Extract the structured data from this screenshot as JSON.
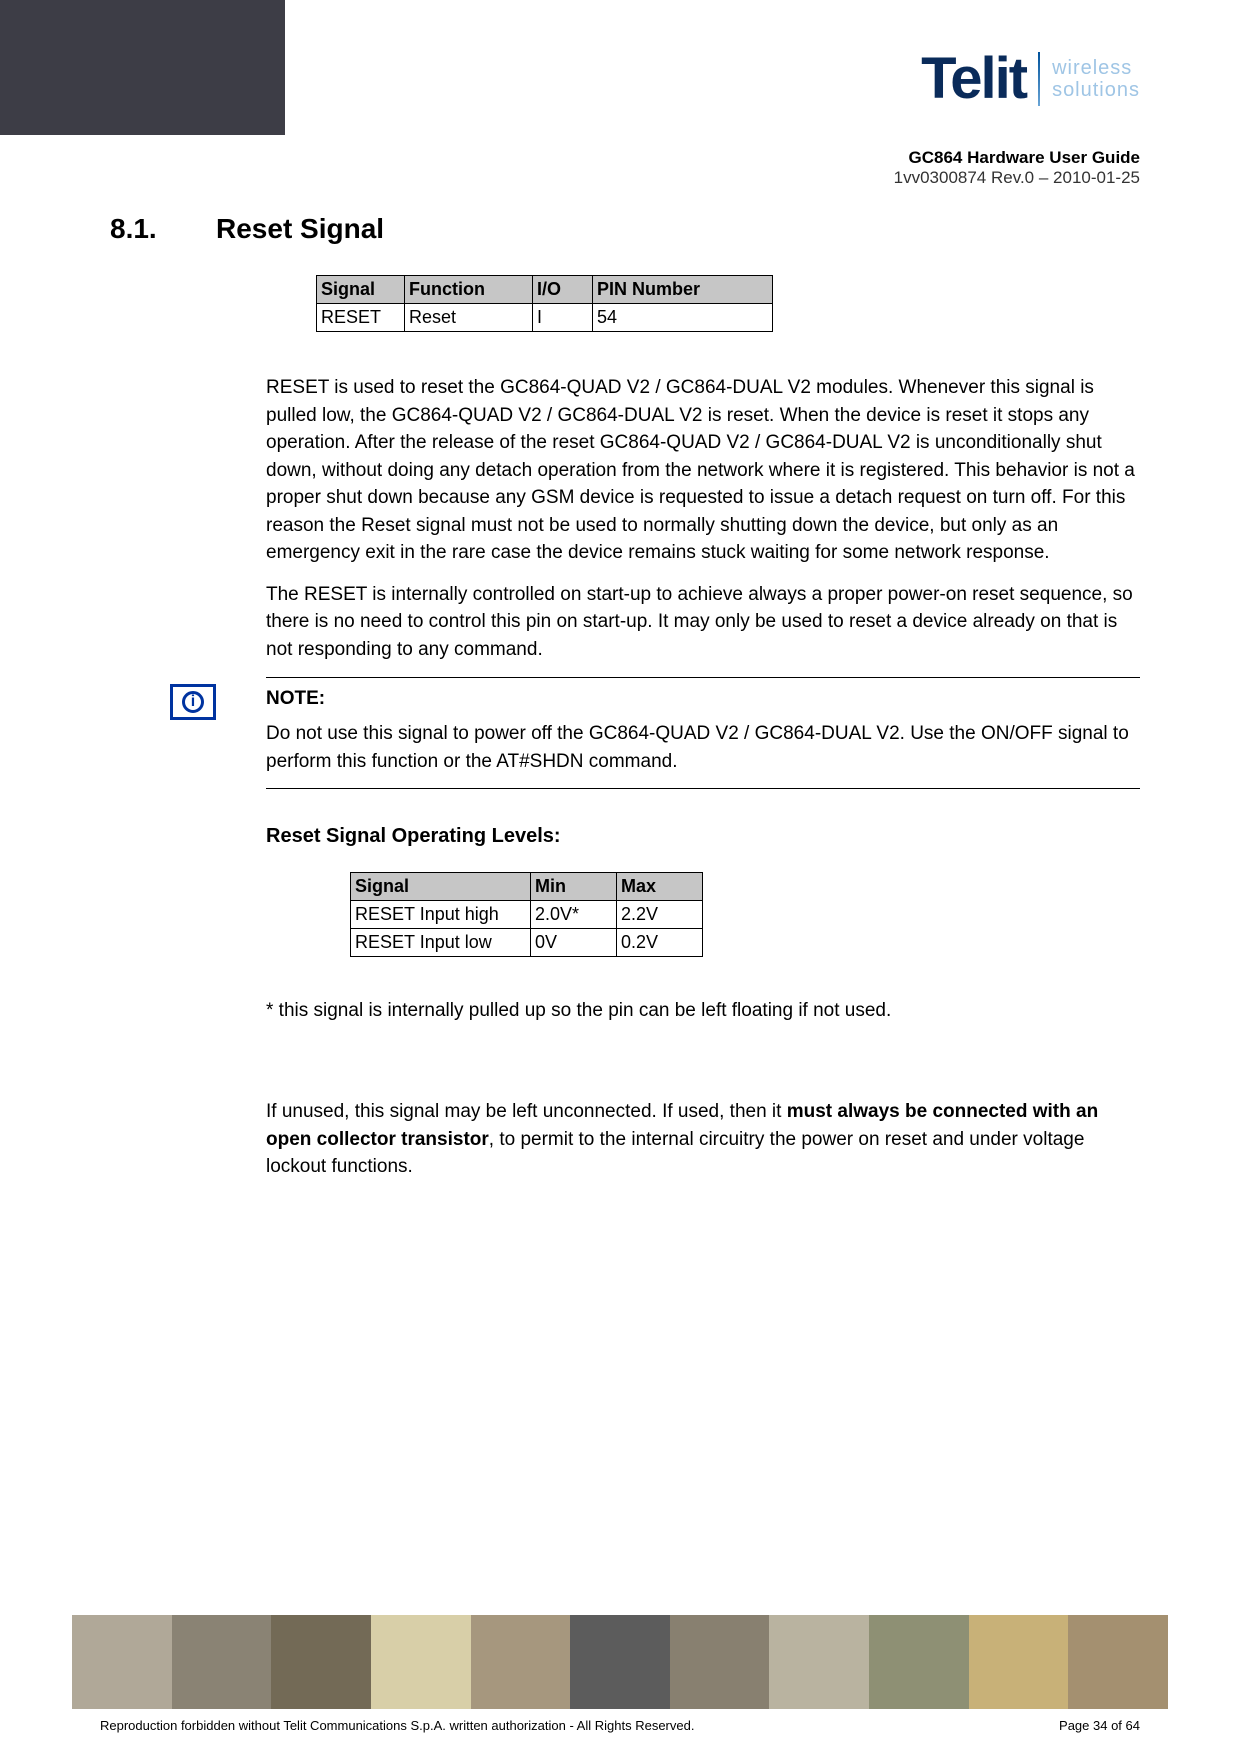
{
  "logo": {
    "brand": "Telit",
    "tagline_line1": "wireless",
    "tagline_line2": "solutions"
  },
  "doc_meta": {
    "title": "GC864 Hardware User Guide",
    "rev": "1vv0300874 Rev.0 – 2010-01-25"
  },
  "section": {
    "num": "8.1.",
    "title": "Reset Signal"
  },
  "sig_table": {
    "headers": {
      "signal": "Signal",
      "function": "Function",
      "io": "I/O",
      "pin": "PIN Number"
    },
    "row": {
      "signal": "RESET",
      "function": "Reset",
      "io": "I",
      "pin": "54"
    },
    "col_widths": {
      "signal": 88,
      "function": 128,
      "io": 60,
      "pin": 180
    }
  },
  "para1": "RESET is used to reset the GC864-QUAD V2 / GC864-DUAL V2 modules. Whenever this signal is pulled low, the GC864-QUAD V2 / GC864-DUAL V2 is reset. When the device is reset it stops any operation. After the release of the reset GC864-QUAD V2 / GC864-DUAL V2 is unconditionally shut down, without doing any detach operation from the network where it is registered. This behavior is not a proper shut down because any GSM device is requested to issue a detach request on turn off. For this reason the Reset signal must not be used to normally shutting down the device, but only as an emergency exit in the rare case the device remains stuck waiting for some network response.",
  "para2": "The RESET is internally controlled on start-up to achieve always a proper power-on reset sequence, so there is no need to control this pin on start-up. It may only be used to reset a device already on that is not responding to any command.",
  "note": {
    "label": "NOTE:",
    "body": "Do not use this signal to power off the GC864-QUAD V2 / GC864-DUAL V2. Use the ON/OFF signal to perform this function or the AT#SHDN command.",
    "icon_glyph": "i"
  },
  "subheading": "Reset Signal Operating Levels:",
  "levels_table": {
    "headers": {
      "signal": "Signal",
      "min": "Min",
      "max": "Max"
    },
    "rows": [
      {
        "signal": "RESET Input high",
        "min": "2.0V*",
        "max": "2.2V"
      },
      {
        "signal": "RESET Input low",
        "min": "0V",
        "max": "0.2V"
      }
    ],
    "col_widths": {
      "signal": 180,
      "min": 86,
      "max": 86
    }
  },
  "footnote": "* this signal is internally pulled up so the pin can be left floating if not used.",
  "para3_pre": "If unused, this signal may be left unconnected. If used, then it ",
  "para3_bold": "must always be connected with an open collector transistor",
  "para3_post": ", to permit to the internal circuitry the power on reset and under voltage lockout functions.",
  "footer": {
    "left": "Reproduction forbidden without Telit Communications S.p.A. written authorization - All Rights Reserved.",
    "right": "Page 34 of 64"
  },
  "strip_colors": [
    "#b0a898",
    "#8a8374",
    "#736a56",
    "#d8cfa8",
    "#a6977e",
    "#5c5c5c",
    "#888070",
    "#b9b3a0",
    "#8e9074",
    "#c8b178",
    "#a49070"
  ]
}
